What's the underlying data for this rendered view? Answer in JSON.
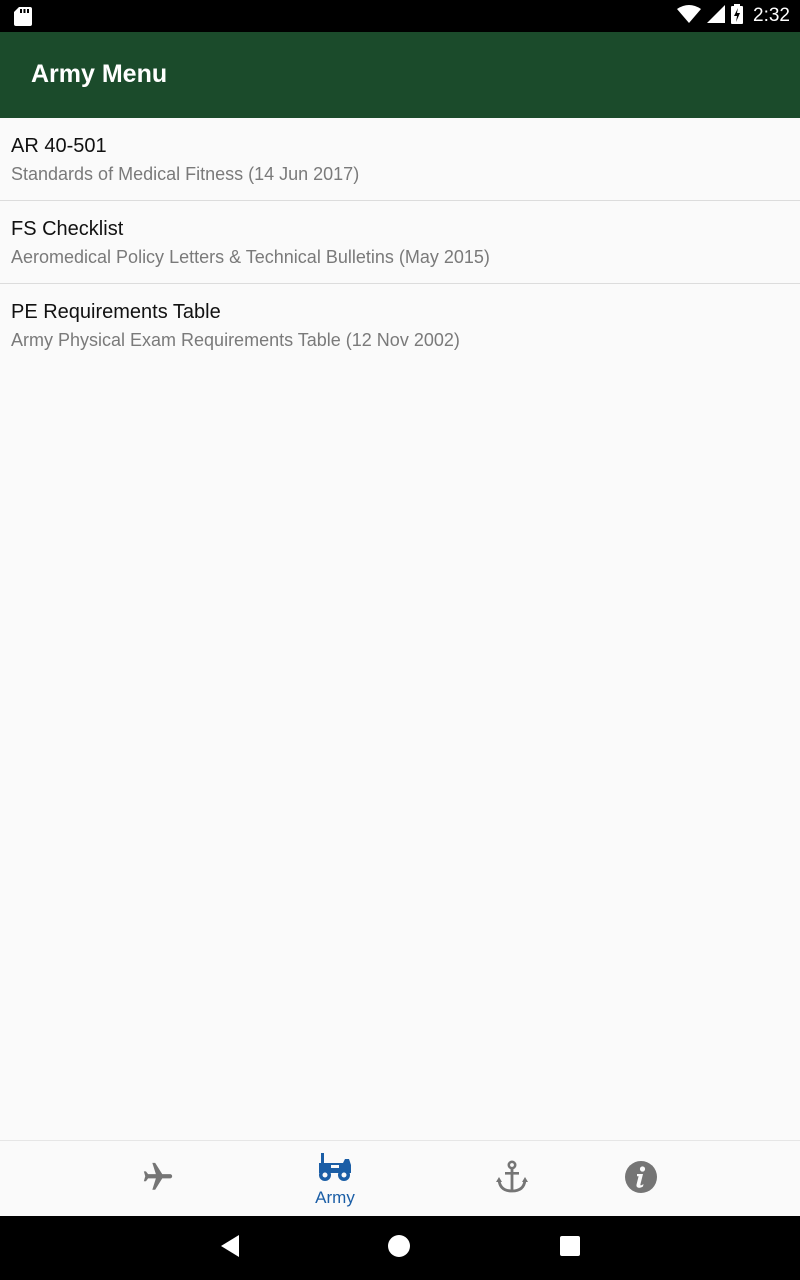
{
  "status_bar": {
    "time": "2:32",
    "icons": [
      "sd-card-icon",
      "wifi-icon",
      "signal-icon",
      "battery-charging-icon"
    ]
  },
  "app_bar": {
    "title": "Army Menu"
  },
  "menu": {
    "items": [
      {
        "title": "AR 40-501",
        "subtitle": "Standards of Medical Fitness (14 Jun 2017)"
      },
      {
        "title": "FS Checklist",
        "subtitle": "Aeromedical Policy Letters & Technical Bulletins (May 2015)"
      },
      {
        "title": "PE Requirements Table",
        "subtitle": "Army Physical Exam Requirements Table (12 Nov 2002)"
      }
    ]
  },
  "bottom_nav": {
    "items": [
      {
        "icon": "airplane-icon",
        "label": "",
        "active": false
      },
      {
        "icon": "jeep-icon",
        "label": "Army",
        "active": true
      },
      {
        "icon": "anchor-icon",
        "label": "",
        "active": false
      },
      {
        "icon": "info-icon",
        "label": "",
        "active": false
      }
    ],
    "active_color": "#1b5ea6",
    "inactive_color": "#757575"
  },
  "system_nav": {
    "icons": [
      "back-icon",
      "home-icon",
      "recents-icon"
    ]
  },
  "colors": {
    "app_bar": "#1b4b2b",
    "background": "#fafafa"
  }
}
